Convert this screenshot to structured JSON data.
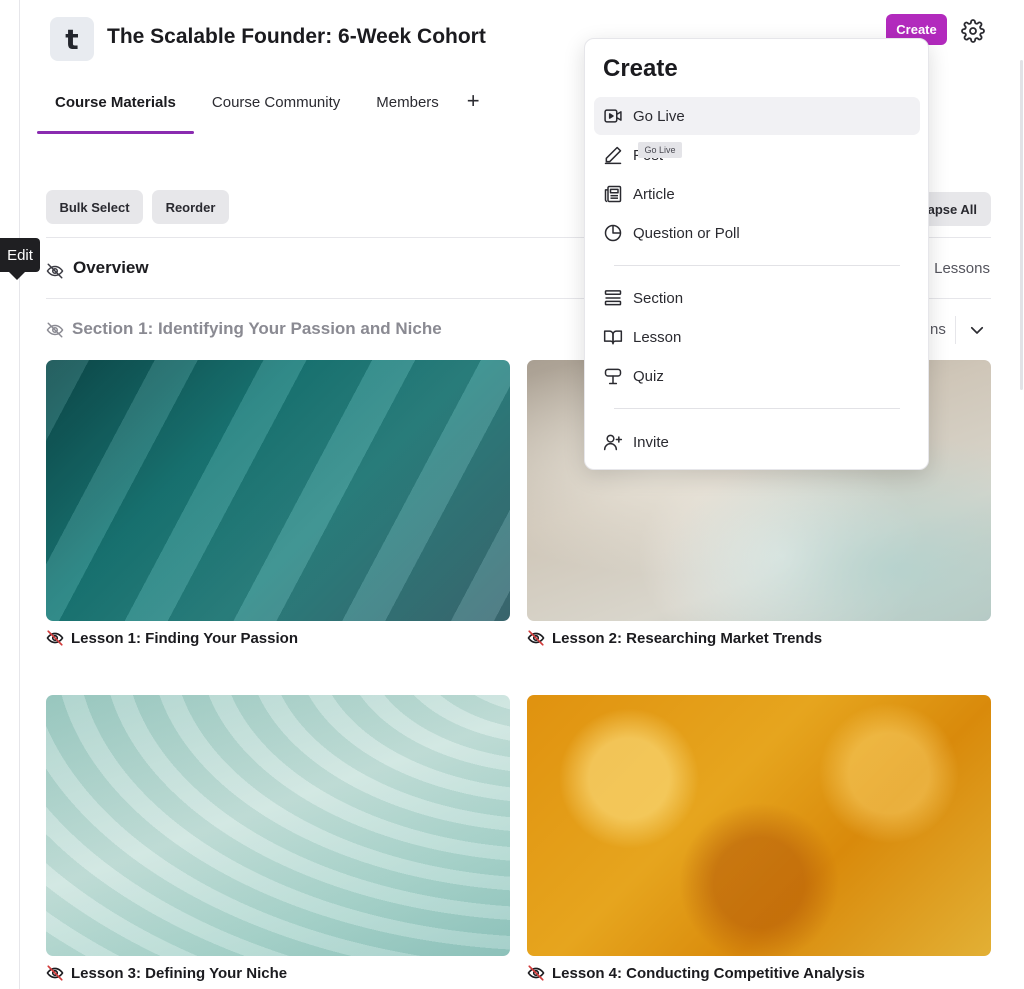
{
  "header": {
    "logo_letter": "t",
    "title": "The Scalable Founder: 6-Week Cohort",
    "create_label": "Create",
    "accent_color": "#b22abd"
  },
  "tabs": [
    {
      "label": "Course Materials",
      "active": true
    },
    {
      "label": "Course Community",
      "active": false
    },
    {
      "label": "Members",
      "active": false
    }
  ],
  "tab_add_symbol": "+",
  "toolbar": {
    "bulk_select_label": "Bulk Select",
    "reorder_label": "Reorder",
    "collapse_label": "apse All"
  },
  "edit_tooltip": "Edit",
  "overview": {
    "title": "Overview",
    "count_text": "Lessons"
  },
  "section": {
    "title": "Section 1: Identifying Your Passion and Niche",
    "count_text": "ns"
  },
  "lessons": [
    {
      "title": "Lesson 1: Finding Your Passion",
      "image": "teal abstract"
    },
    {
      "title": "Lesson 2: Researching Market Trends",
      "image": "grey clouds"
    },
    {
      "title": "Lesson 3: Defining Your Niche",
      "image": "mint waves"
    },
    {
      "title": "Lesson 4: Conducting Competitive Analysis",
      "image": "orange texture"
    }
  ],
  "create_menu": {
    "title": "Create",
    "tooltip": "Go Live",
    "groups": [
      [
        {
          "label": "Go Live",
          "icon": "video-icon",
          "highlighted": true
        },
        {
          "label": "Post",
          "icon": "pen-icon"
        },
        {
          "label": "Article",
          "icon": "newspaper-icon"
        },
        {
          "label": "Question or Poll",
          "icon": "pie-chart-icon"
        }
      ],
      [
        {
          "label": "Section",
          "icon": "section-icon"
        },
        {
          "label": "Lesson",
          "icon": "book-icon"
        },
        {
          "label": "Quiz",
          "icon": "quiz-sign-icon"
        }
      ],
      [
        {
          "label": "Invite",
          "icon": "user-plus-icon"
        }
      ]
    ]
  }
}
